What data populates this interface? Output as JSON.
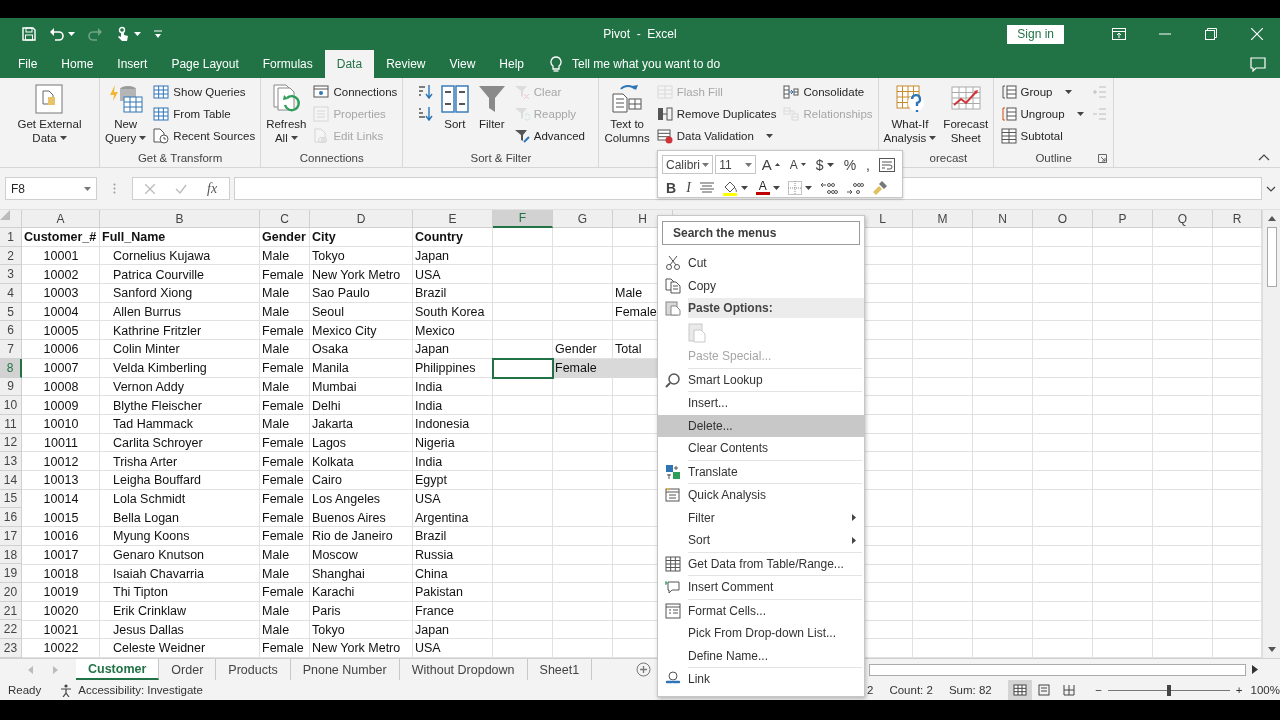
{
  "title_bar": {
    "title": "Pivot  -  Excel",
    "sign_in": "Sign in"
  },
  "tabs": [
    {
      "label": "File",
      "selected": false
    },
    {
      "label": "Home",
      "selected": false
    },
    {
      "label": "Insert",
      "selected": false
    },
    {
      "label": "Page Layout",
      "selected": false
    },
    {
      "label": "Formulas",
      "selected": false
    },
    {
      "label": "Data",
      "selected": true
    },
    {
      "label": "Review",
      "selected": false
    },
    {
      "label": "View",
      "selected": false
    },
    {
      "label": "Help",
      "selected": false
    }
  ],
  "tell_me": "Tell me what you want to do",
  "ribbon": {
    "groups": [
      {
        "columns": [
          {
            "kind": "large",
            "items": [
              {
                "label": "Get External\nData",
                "dropdown": true,
                "disabled": false
              }
            ]
          }
        ]
      },
      {
        "label": "Get & Transform",
        "columns": [
          {
            "kind": "large",
            "items": [
              {
                "label": "New\nQuery",
                "dropdown": true,
                "disabled": false
              }
            ]
          },
          {
            "kind": "small",
            "items": [
              {
                "label": "Show Queries",
                "disabled": false
              },
              {
                "label": "From Table",
                "disabled": false
              },
              {
                "label": "Recent Sources",
                "disabled": false
              }
            ]
          }
        ]
      },
      {
        "label": "Connections",
        "columns": [
          {
            "kind": "large",
            "items": [
              {
                "label": "Refresh\nAll",
                "dropdown": true,
                "disabled": false
              }
            ]
          },
          {
            "kind": "small",
            "items": [
              {
                "label": "Connections",
                "disabled": false
              },
              {
                "label": "Properties",
                "disabled": true
              },
              {
                "label": "Edit Links",
                "disabled": true
              }
            ]
          }
        ]
      },
      {
        "label": "Sort & Filter",
        "columns": [
          {
            "kind": "icons",
            "items": [
              {
                "disabled": false
              },
              {
                "disabled": false
              }
            ]
          },
          {
            "kind": "large",
            "items": [
              {
                "label": "Sort",
                "disabled": false
              }
            ]
          },
          {
            "kind": "large",
            "items": [
              {
                "label": "Filter",
                "disabled": false
              }
            ]
          },
          {
            "kind": "small",
            "items": [
              {
                "label": "Clear",
                "disabled": true
              },
              {
                "label": "Reapply",
                "disabled": true
              },
              {
                "label": "Advanced",
                "disabled": false
              }
            ]
          }
        ]
      },
      {
        "columns": [
          {
            "kind": "large",
            "items": [
              {
                "label": "Text to\nColumns",
                "disabled": false
              }
            ]
          },
          {
            "kind": "small",
            "items": [
              {
                "label": "Flash Fill",
                "disabled": true
              },
              {
                "label": "Remove Duplicates",
                "disabled": false
              },
              {
                "label": "Data Validation",
                "dropdown": true,
                "disabled": false
              }
            ]
          },
          {
            "kind": "small",
            "items": [
              {
                "label": "Consolidate",
                "disabled": false
              },
              {
                "label": "Relationships",
                "disabled": true
              }
            ]
          }
        ]
      },
      {
        "label": "orecast",
        "columns": [
          {
            "kind": "large",
            "items": [
              {
                "label": "What-If\nAnalysis",
                "dropdown": true,
                "disabled": false
              }
            ]
          },
          {
            "kind": "large",
            "items": [
              {
                "label": "Forecast\nSheet",
                "disabled": false
              }
            ]
          }
        ]
      },
      {
        "label": "Outline",
        "launcher": true,
        "columns": [
          {
            "kind": "small",
            "items": [
              {
                "label": "Group",
                "dropdown": true,
                "disabled": false
              },
              {
                "label": "Ungroup",
                "dropdown": true,
                "disabled": false
              },
              {
                "label": "Subtotal",
                "disabled": false
              }
            ]
          },
          {
            "kind": "icons",
            "items": [
              {
                "disabled": true
              },
              {
                "disabled": true
              }
            ]
          }
        ]
      }
    ]
  },
  "formula_bar": {
    "name_box": "F8",
    "function_label": "fx"
  },
  "mini_toolbar": {
    "font": "Calibri",
    "size": "11",
    "row1": [
      {
        "kind": "grow",
        "text": "A"
      },
      {
        "kind": "shrink",
        "text": "A"
      },
      {
        "kind": "glyph",
        "text": "$",
        "dropdown": true
      },
      {
        "kind": "glyph",
        "text": "%"
      },
      {
        "kind": "glyph",
        "text": ","
      },
      {
        "kind": "icon"
      }
    ],
    "row2": [
      {
        "kind": "glyph",
        "text": "B"
      },
      {
        "kind": "glyph",
        "text": "I"
      },
      {
        "kind": "icon"
      },
      {
        "kind": "icon",
        "dropdown": true
      },
      {
        "kind": "font_color",
        "text": "A",
        "dropdown": true
      },
      {
        "kind": "icon",
        "dropdown": true
      },
      {
        "kind": "icon"
      },
      {
        "kind": "icon"
      },
      {
        "kind": "icon"
      }
    ]
  },
  "sheet": {
    "columns": [
      "A",
      "B",
      "C",
      "D",
      "E",
      "F",
      "G",
      "H",
      "L",
      "M",
      "N",
      "O",
      "P",
      "Q",
      "R"
    ],
    "rows": [
      {
        "number": "1",
        "bold": true,
        "cells": {
          "A": "Customer_#",
          "B": "Full_Name",
          "C": "Gender",
          "D": "City",
          "E": "Country"
        }
      },
      {
        "number": "2",
        "cells": {
          "A": "10001",
          "B": "Cornelius Kujawa",
          "C": "Male",
          "D": "Tokyo",
          "E": "Japan"
        }
      },
      {
        "number": "3",
        "cells": {
          "A": "10002",
          "B": "Patrica Courville",
          "C": "Female",
          "D": "New York Metro",
          "E": "USA"
        }
      },
      {
        "number": "4",
        "cells": {
          "A": "10003",
          "B": "Sanford Xiong",
          "C": "Male",
          "D": "Sao Paulo",
          "E": "Brazil",
          "H": "Male"
        }
      },
      {
        "number": "5",
        "cells": {
          "A": "10004",
          "B": "Allen Burrus",
          "C": "Male",
          "D": "Seoul",
          "E": "South Korea",
          "H": "Female"
        }
      },
      {
        "number": "6",
        "cells": {
          "A": "10005",
          "B": "Kathrine Fritzler",
          "C": "Female",
          "D": "Mexico City",
          "E": "Mexico"
        }
      },
      {
        "number": "7",
        "cells": {
          "A": "10006",
          "B": "Colin Minter",
          "C": "Male",
          "D": "Osaka",
          "E": "Japan",
          "G": "Gender",
          "H": "Total"
        }
      },
      {
        "number": "8",
        "cells": {
          "A": "10007",
          "B": "Velda Kimberling",
          "C": "Female",
          "D": "Manila",
          "E": "Philippines",
          "F": {
            "selected": true
          },
          "G": {
            "text": "Female",
            "shaded": true
          },
          "H": {
            "shaded": true
          }
        }
      },
      {
        "number": "9",
        "cells": {
          "A": "10008",
          "B": "Vernon Addy",
          "C": "Male",
          "D": "Mumbai",
          "E": "India"
        }
      },
      {
        "number": "10",
        "cells": {
          "A": "10009",
          "B": "Blythe Fleischer",
          "C": "Female",
          "D": "Delhi",
          "E": "India"
        }
      },
      {
        "number": "11",
        "cells": {
          "A": "10010",
          "B": "Tad Hammack",
          "C": "Male",
          "D": "Jakarta",
          "E": "Indonesia"
        }
      },
      {
        "number": "12",
        "cells": {
          "A": "10011",
          "B": "Carlita Schroyer",
          "C": "Female",
          "D": "Lagos",
          "E": "Nigeria"
        }
      },
      {
        "number": "13",
        "cells": {
          "A": "10012",
          "B": "Trisha Arter",
          "C": "Female",
          "D": "Kolkata",
          "E": "India"
        }
      },
      {
        "number": "14",
        "cells": {
          "A": "10013",
          "B": "Leigha Bouffard",
          "C": "Female",
          "D": "Cairo",
          "E": "Egypt"
        }
      },
      {
        "number": "15",
        "cells": {
          "A": "10014",
          "B": "Lola Schmidt",
          "C": "Female",
          "D": "Los Angeles",
          "E": "USA"
        }
      },
      {
        "number": "16",
        "cells": {
          "A": "10015",
          "B": "Bella Logan",
          "C": "Female",
          "D": "Buenos Aires",
          "E": "Argentina"
        }
      },
      {
        "number": "17",
        "cells": {
          "A": "10016",
          "B": "Myung Koons",
          "C": "Female",
          "D": "Rio de Janeiro",
          "E": "Brazil"
        }
      },
      {
        "number": "18",
        "cells": {
          "A": "10017",
          "B": "Genaro Knutson",
          "C": "Male",
          "D": "Moscow",
          "E": "Russia"
        }
      },
      {
        "number": "19",
        "cells": {
          "A": "10018",
          "B": "Isaiah Chavarria",
          "C": "Male",
          "D": "Shanghai",
          "E": "China"
        }
      },
      {
        "number": "20",
        "cells": {
          "A": "10019",
          "B": "Thi Tipton",
          "C": "Female",
          "D": "Karachi",
          "E": "Pakistan"
        }
      },
      {
        "number": "21",
        "cells": {
          "A": "10020",
          "B": "Erik Crinklaw",
          "C": "Male",
          "D": "Paris",
          "E": "France"
        }
      },
      {
        "number": "22",
        "cells": {
          "A": "10021",
          "B": "Jesus Dallas",
          "C": "Male",
          "D": "Tokyo",
          "E": "Japan"
        }
      },
      {
        "number": "23",
        "cells": {
          "A": "10022",
          "B": "Celeste Weidner",
          "C": "Female",
          "D": "New York Metro",
          "E": "USA"
        }
      }
    ]
  },
  "context_menu": {
    "items": [
      {
        "kind": "search",
        "placeholder": "Search the menus"
      },
      {
        "kind": "item",
        "label": "Cut",
        "disabled": false,
        "selected": false
      },
      {
        "kind": "item",
        "label": "Copy",
        "disabled": false,
        "selected": false
      },
      {
        "kind": "header",
        "label": "Paste Options:"
      },
      {
        "kind": "paste_icon"
      },
      {
        "kind": "item",
        "label": "Paste Special...",
        "disabled": true,
        "selected": false
      },
      {
        "kind": "separator"
      },
      {
        "kind": "item",
        "label": "Smart Lookup",
        "disabled": false,
        "selected": false
      },
      {
        "kind": "separator"
      },
      {
        "kind": "item",
        "label": "Insert...",
        "disabled": false,
        "selected": false
      },
      {
        "kind": "item",
        "label": "Delete...",
        "disabled": false,
        "selected": true
      },
      {
        "kind": "item",
        "label": "Clear Contents",
        "disabled": false,
        "selected": false
      },
      {
        "kind": "separator"
      },
      {
        "kind": "item",
        "label": "Translate",
        "disabled": false,
        "selected": false
      },
      {
        "kind": "separator"
      },
      {
        "kind": "item",
        "label": "Quick Analysis",
        "disabled": false,
        "selected": false
      },
      {
        "kind": "item",
        "label": "Filter",
        "disabled": false,
        "selected": false,
        "submenu": true
      },
      {
        "kind": "item",
        "label": "Sort",
        "disabled": false,
        "selected": false,
        "submenu": true
      },
      {
        "kind": "separator"
      },
      {
        "kind": "item",
        "label": "Get Data from Table/Range...",
        "disabled": false,
        "selected": false
      },
      {
        "kind": "separator"
      },
      {
        "kind": "item",
        "label": "Insert Comment",
        "disabled": false,
        "selected": false
      },
      {
        "kind": "separator"
      },
      {
        "kind": "item",
        "label": "Format Cells...",
        "disabled": false,
        "selected": false
      },
      {
        "kind": "item",
        "label": "Pick From Drop-down List...",
        "disabled": false,
        "selected": false
      },
      {
        "kind": "item",
        "label": "Define Name...",
        "disabled": false,
        "selected": false
      },
      {
        "kind": "separator"
      },
      {
        "kind": "item",
        "label": "Link",
        "disabled": false,
        "selected": false
      }
    ]
  },
  "sheet_tabs": [
    {
      "label": "Customer",
      "selected": true
    },
    {
      "label": "Order",
      "selected": false
    },
    {
      "label": "Products",
      "selected": false
    },
    {
      "label": "Pnone Number",
      "selected": false
    },
    {
      "label": "Without Dropdown",
      "selected": false
    },
    {
      "label": "Sheet1",
      "selected": false
    }
  ],
  "status_bar": {
    "mode": "Ready",
    "accessibility": "Accessibility: Investigate",
    "stats": [
      "2",
      "Count: 2",
      "Sum: 82"
    ],
    "views": [
      {
        "selected": true
      },
      {
        "selected": false
      },
      {
        "selected": false
      }
    ],
    "zoom": {
      "minus": "−",
      "plus": "+",
      "level": 0.5,
      "reading": "100%"
    }
  }
}
